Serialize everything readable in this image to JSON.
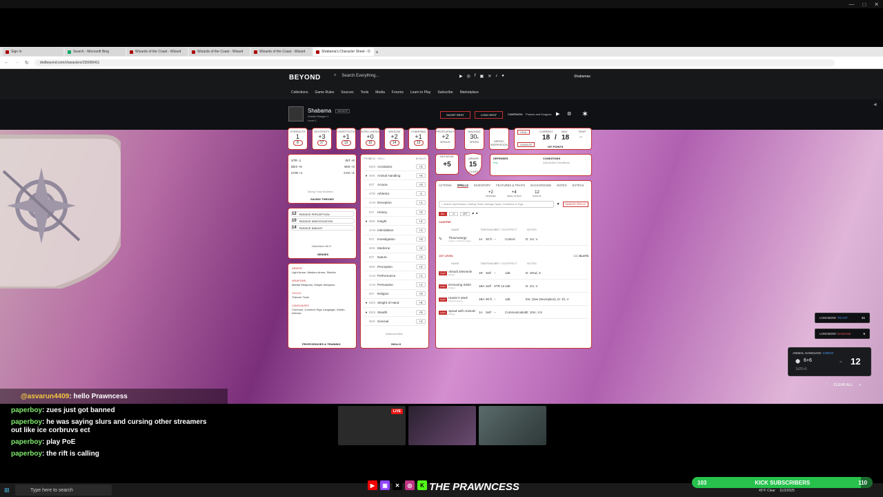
{
  "browser": {
    "tabs": [
      {
        "label": "Sign In",
        "active": false
      },
      {
        "label": "Search - Microsoft Bing",
        "active": false
      },
      {
        "label": "Wizards of the Coast - Wizard",
        "active": false
      },
      {
        "label": "Wizards of the Coast - Wizard",
        "active": false
      },
      {
        "label": "Wizards of the Coast - Wizard",
        "active": false
      },
      {
        "label": "Shabama's Character Sheet - D",
        "active": true
      }
    ],
    "url": "dndbeyond.com/characters/155065411"
  },
  "ddb": {
    "logo": "BEYOND",
    "search_placeholder": "Search Everything...",
    "nav": [
      "Collections",
      "Game Rules",
      "Sources",
      "Tools",
      "Media",
      "Forums",
      "Learn to Play",
      "Subscribe",
      "Marketplace"
    ],
    "username": "Shabamas"
  },
  "character": {
    "name": "Shabama",
    "tag": "MANAGE",
    "subtitle": "Goliath Ranger 1",
    "level": "Level 1",
    "short_rest": "SHORT REST",
    "long_rest": "LONG REST",
    "campaign_label": "CAMPAIGN:",
    "campaign": "Prawns and Dragons"
  },
  "stats": [
    {
      "label": "STRENGTH",
      "mod": "1",
      "score": "8",
      "sign": ""
    },
    {
      "label": "DEXTERITY",
      "mod": "3",
      "score": "17",
      "sign": "+"
    },
    {
      "label": "CONSTITUTION",
      "mod": "1",
      "score": "13",
      "sign": "+"
    },
    {
      "label": "INTELLIGENCE",
      "mod": "0",
      "score": "10",
      "sign": "+"
    },
    {
      "label": "WISDOM",
      "mod": "2",
      "score": "14",
      "sign": "+"
    },
    {
      "label": "CHARISMA",
      "mod": "1",
      "score": "13",
      "sign": "+"
    }
  ],
  "top": {
    "proficiency_label": "PROFICIENCY",
    "proficiency": "+2",
    "bonus_label": "BONUS",
    "walking_label": "WALKING",
    "speed": "30",
    "speed_unit": "ft",
    "speed_label": "SPEED",
    "heroic_label": "HEROIC INSPIRATION",
    "heal": "HEAL",
    "damage": "DAMAGE",
    "current_label": "CURRENT",
    "max_label": "MAX",
    "temp_label": "TEMP",
    "hp_current": "18",
    "hp_max": "18",
    "hp_temp": "--",
    "hp_label": "HIT POINTS"
  },
  "saves": {
    "rows": [
      {
        "a": "STR",
        "av": "-1",
        "b": "INT",
        "bv": "+0"
      },
      {
        "a": "DEX",
        "av": "+5",
        "b": "WIS",
        "bv": "+2"
      },
      {
        "a": "CON",
        "av": "+1",
        "b": "CHA",
        "bv": "+1"
      }
    ],
    "note": "Saving Throw Modifiers",
    "title": "SAVING THROWS"
  },
  "senses": {
    "rows": [
      {
        "value": "12",
        "label": "PASSIVE PERCEPTION"
      },
      {
        "value": "10",
        "label": "PASSIVE INVESTIGATION"
      },
      {
        "value": "14",
        "label": "PASSIVE INSIGHT"
      }
    ],
    "darkvision": "Darkvision 60 ft.",
    "title": "SENSES"
  },
  "profs": {
    "armor_label": "ARMOR",
    "armor": "Light Armor, Medium Armor, Shields",
    "weapons_label": "WEAPONS",
    "weapons": "Martial Weapons, Simple Weapons",
    "tools_label": "TOOLS",
    "tools": "Thieves' Tools",
    "languages_label": "LANGUAGES",
    "languages": "Common, Common Sign Language, Goblin, Infernal",
    "title": "PROFICIENCIES & TRAINING"
  },
  "skills": {
    "headers": {
      "prof": "PROF",
      "mod": "MOD",
      "skill": "SKILL",
      "bonus": "BONUS"
    },
    "rows": [
      {
        "prof": "",
        "attr": "DEX",
        "name": "Acrobatics",
        "bonus": "+3"
      },
      {
        "prof": "●",
        "attr": "WIS",
        "name": "Animal Handling",
        "bonus": "+6"
      },
      {
        "prof": "",
        "attr": "INT",
        "name": "Arcana",
        "bonus": "+0"
      },
      {
        "prof": "",
        "attr": "STR",
        "name": "Athletics",
        "bonus": "-1"
      },
      {
        "prof": "",
        "attr": "CHA",
        "name": "Deception",
        "bonus": "+1"
      },
      {
        "prof": "",
        "attr": "INT",
        "name": "History",
        "bonus": "+0"
      },
      {
        "prof": "●",
        "attr": "WIS",
        "name": "Insight",
        "bonus": "+4"
      },
      {
        "prof": "",
        "attr": "CHA",
        "name": "Intimidation",
        "bonus": "+1"
      },
      {
        "prof": "",
        "attr": "INT",
        "name": "Investigation",
        "bonus": "+0"
      },
      {
        "prof": "",
        "attr": "WIS",
        "name": "Medicine",
        "bonus": "+2"
      },
      {
        "prof": "",
        "attr": "INT",
        "name": "Nature",
        "bonus": "+0"
      },
      {
        "prof": "",
        "attr": "WIS",
        "name": "Perception",
        "bonus": "+2"
      },
      {
        "prof": "",
        "attr": "CHA",
        "name": "Performance",
        "bonus": "+1"
      },
      {
        "prof": "",
        "attr": "CHA",
        "name": "Persuasion",
        "bonus": "+1"
      },
      {
        "prof": "",
        "attr": "INT",
        "name": "Religion",
        "bonus": "+0"
      },
      {
        "prof": "●",
        "attr": "DEX",
        "name": "Sleight of Hand",
        "bonus": "+5"
      },
      {
        "prof": "●",
        "attr": "DEX",
        "name": "Stealth",
        "bonus": "+5"
      },
      {
        "prof": "",
        "attr": "WIS",
        "name": "Survival",
        "bonus": "+2"
      }
    ],
    "additional": "Additional Skills",
    "title": "SKILLS"
  },
  "combat": {
    "initiative_label": "INITIATIVE",
    "initiative": "+5",
    "armor_label": "ARMOR",
    "ac": "15",
    "class_label": "CLASS",
    "defenses_label": "DEFENSES",
    "defenses": "Fey",
    "conditions_label": "CONDITIONS",
    "conditions": "Add Active Conditions"
  },
  "tabs": [
    "ACTIONS",
    "SPELLS",
    "INVENTORY",
    "FEATURES & TRAITS",
    "BACKGROUND",
    "NOTES",
    "EXTRAS"
  ],
  "spells": {
    "stats": [
      {
        "value": "+2",
        "label": "MODIFIER"
      },
      {
        "value": "+4",
        "label": "SPELL ATTACK"
      },
      {
        "value": "12",
        "label": "SAVE DC"
      }
    ],
    "search_placeholder": "Search Spell Names, Casting Times, Damage Types, Conditions or Tags",
    "manage": "MANAGE SPELLS",
    "filters": [
      "ALL",
      "-0-",
      "1ST"
    ],
    "cantrip_label": "CANTRIP",
    "first_label": "1ST LEVEL",
    "slots_label": "SLOTS",
    "columns": {
      "name": "NAME",
      "time": "TIME",
      "range": "RANGE",
      "hit": "HIT / DC",
      "effect": "EFFECT",
      "notes": "NOTES"
    },
    "cantrips": [
      {
        "name": "Thaumaturgy",
        "source": "Legacy • Infernal Legacy",
        "time": "1A",
        "range": "30 ft.",
        "hit": "--",
        "effect": "Control",
        "notes": "D: 1m, V"
      }
    ],
    "first": [
      {
        "name": "Absorb Elements",
        "source": "Ranger",
        "time": "1R",
        "range": "Self",
        "hit": "--",
        "effect": "1d6",
        "notes": "D: 1Rnd, S"
      },
      {
        "name": "Ensnaring Strike",
        "source": "Ranger",
        "time": "1BA",
        "range": "Self",
        "hit": "STR 12",
        "effect": "1d6",
        "notes": "D: 1m, V"
      },
      {
        "name": "Hunter's Mark",
        "source": "Favored Enemy",
        "time": "1BA",
        "range": "90 ft.",
        "hit": "--",
        "effect": "1d6",
        "notes": "Ext. (See Description), D: 1h, V"
      },
      {
        "name": "Speak with Animals",
        "source": "Ranger",
        "time": "1A",
        "range": "Self",
        "hit": "--",
        "effect": "Communication",
        "notes": "D: 10m, V,S"
      }
    ],
    "cast_label": "CAST"
  },
  "rolls": {
    "r1_label": "LONGBOW:",
    "r1_type": "TO HIT",
    "r1_value": "21",
    "r2_label": "LONGBOW:",
    "r2_type": "DAMAGE",
    "r2_value": "6",
    "r3_label": "ANIMAL HANDLING:",
    "r3_type": "CHECK",
    "r3_formula": "6+6",
    "r3_dice": "1d20+6",
    "r3_total": "12",
    "clear_all": "CLEAR ALL"
  },
  "chat": {
    "highlight_user": "@asvarun4409",
    "highlight_msg": ": hello Prawncess",
    "lines": [
      {
        "user": "paperboy",
        "msg": ": zues just got banned"
      },
      {
        "user": "paperboy",
        "msg": ": he was saying slurs and cursing other streamers out like ice corbruvs ect"
      },
      {
        "user": "paperboy",
        "msg": ": play PoE"
      },
      {
        "user": "paperboy",
        "msg": ": the rift is calling"
      }
    ]
  },
  "cams": {
    "live": "LIVE"
  },
  "overlay": {
    "streamer": "THE PRAWNCESS",
    "sub_start": "103",
    "sub_label": "KICK SUBSCRIBERS",
    "sub_goal": "110",
    "sub_progress": 0.936
  },
  "taskbar": {
    "search": "Type here to search",
    "weather": "45°F Clear",
    "date": "11/3/2025"
  }
}
